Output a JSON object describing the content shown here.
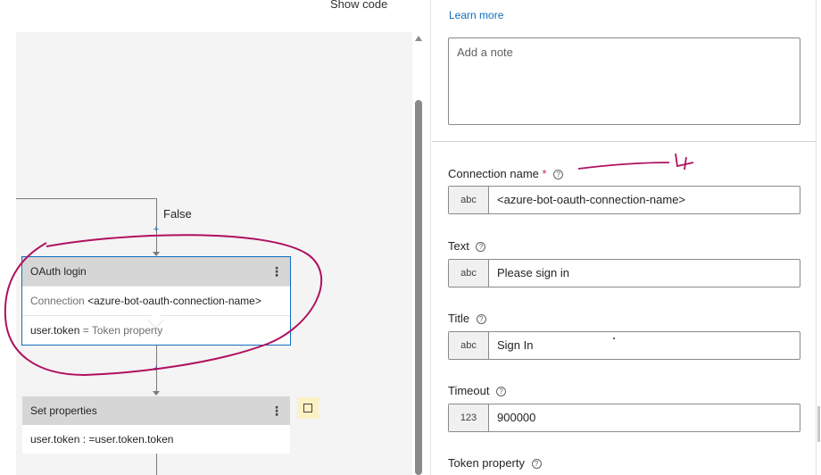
{
  "toolbar": {
    "show_code": "Show code"
  },
  "canvas": {
    "false_label": "False",
    "oauth_node": {
      "title": "OAuth login",
      "connection_label": "Connection",
      "connection_value": "<azure-bot-oauth-connection-name>",
      "token_var": "user.token",
      "token_eq": "=",
      "token_label": "Token property"
    },
    "set_props_node": {
      "title": "Set properties",
      "assignment": "user.token : =user.token.token"
    },
    "plus": "+",
    "menu": "⋮"
  },
  "panel": {
    "learn_more": "Learn more",
    "note_placeholder": "Add a note",
    "fields": [
      {
        "label": "Connection name",
        "required": "*",
        "type": "abc",
        "value": "<azure-bot-oauth-connection-name>"
      },
      {
        "label": "Text",
        "type": "abc",
        "value": "Please sign in"
      },
      {
        "label": "Title",
        "type": "abc",
        "value": "Sign In"
      },
      {
        "label": "Timeout",
        "type": "123",
        "value": "900000"
      },
      {
        "label": "Token property"
      }
    ],
    "help_glyph": "?"
  },
  "annotation": {
    "color": "#b0105e",
    "mark": "4"
  }
}
